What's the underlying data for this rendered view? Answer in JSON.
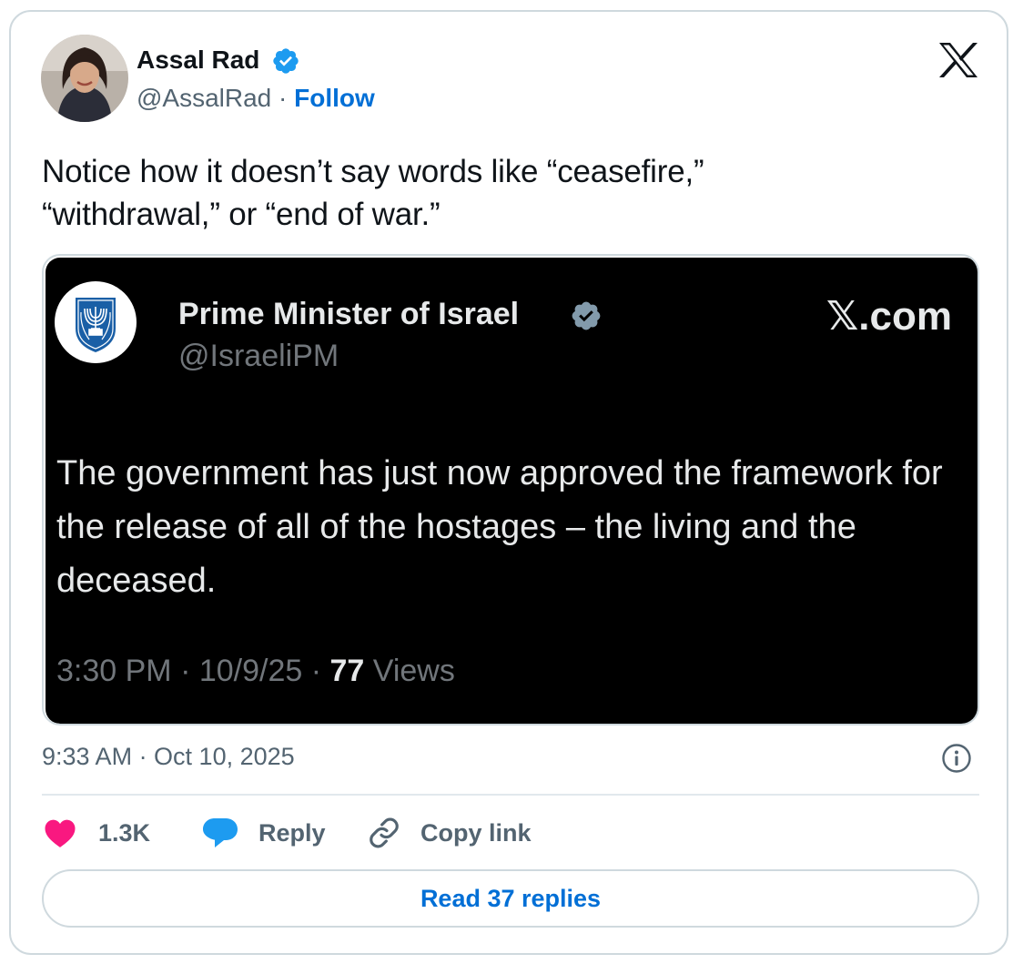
{
  "author": {
    "name": "Assal Rad",
    "handle": "@AssalRad",
    "separator": " · ",
    "follow_label": "Follow"
  },
  "tweet": {
    "text": "Notice how it doesn’t say words like “ceasefire,” “withdrawal,” or “end of war.”",
    "timestamp": "9:33 AM · Oct 10, 2025"
  },
  "embedded": {
    "name": "Prime Minister of Israel",
    "handle": "@IsraeliPM",
    "site": "𝕏.com",
    "text": "The government has just now approved the framework for the release of all of the hostages – the living and the deceased.",
    "meta_prefix": "3:30 PM · 10/9/25 · ",
    "views_count": "77",
    "views_label": " Views"
  },
  "actions": {
    "likes": "1.3K",
    "reply": "Reply",
    "copy_link": "Copy link"
  },
  "read_replies": "Read 37 replies",
  "colors": {
    "link_blue": "#006fd6",
    "verified_blue": "#1d9bf0",
    "like_pink": "#f91880",
    "reply_blue": "#1d9bf0",
    "secondary_text": "#536471"
  },
  "icons": {
    "close": "x-logo-icon",
    "verified": "verified-badge-icon",
    "gov_verified": "gray-verified-badge-icon",
    "info": "info-icon",
    "like": "heart-icon",
    "reply": "speech-bubble-icon",
    "copy": "link-icon"
  }
}
